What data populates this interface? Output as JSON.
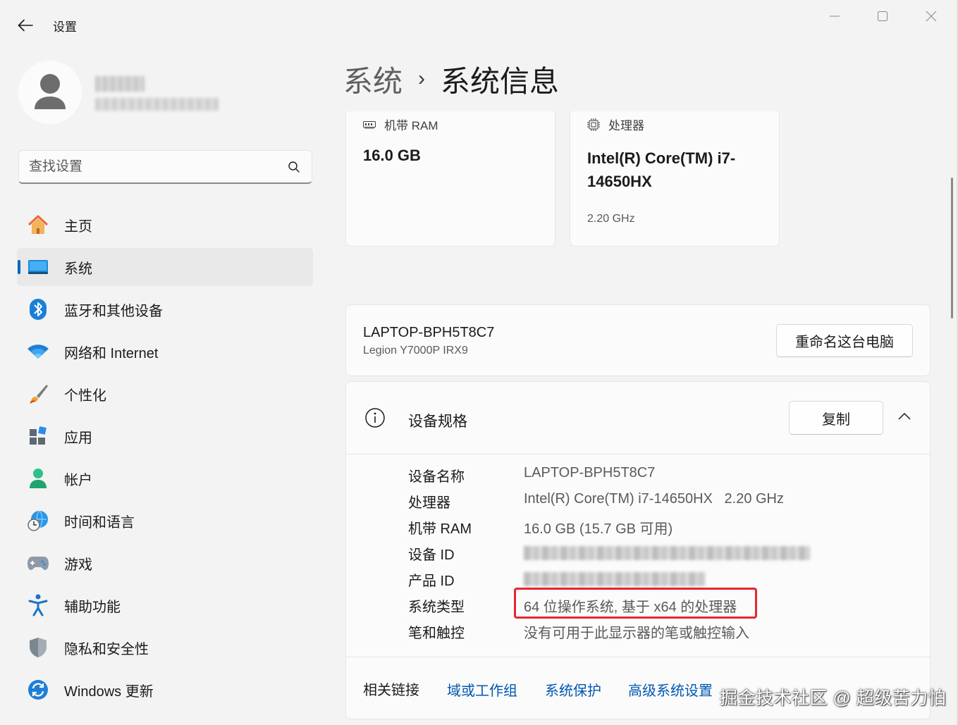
{
  "window": {
    "app_title": "设置",
    "controls": [
      "minimize",
      "maximize",
      "close"
    ]
  },
  "user": {
    "name": "",
    "email": ""
  },
  "search": {
    "placeholder": "查找设置"
  },
  "sidebar": {
    "items": [
      {
        "label": "主页",
        "icon": "home-icon"
      },
      {
        "label": "系统",
        "icon": "system-icon",
        "active": true
      },
      {
        "label": "蓝牙和其他设备",
        "icon": "bluetooth-icon"
      },
      {
        "label": "网络和 Internet",
        "icon": "wifi-icon"
      },
      {
        "label": "个性化",
        "icon": "brush-icon"
      },
      {
        "label": "应用",
        "icon": "apps-icon"
      },
      {
        "label": "帐户",
        "icon": "account-icon"
      },
      {
        "label": "时间和语言",
        "icon": "globe-clock-icon"
      },
      {
        "label": "游戏",
        "icon": "gamepad-icon"
      },
      {
        "label": "辅助功能",
        "icon": "accessibility-icon"
      },
      {
        "label": "隐私和安全性",
        "icon": "shield-icon"
      },
      {
        "label": "Windows 更新",
        "icon": "update-icon"
      }
    ]
  },
  "breadcrumb": {
    "parent": "系统",
    "separator": "›",
    "current": "系统信息"
  },
  "summary_cards": {
    "ram": {
      "label": "机带 RAM",
      "value": "16.0 GB"
    },
    "cpu": {
      "label": "处理器",
      "value": "Intel(R) Core(TM) i7-14650HX",
      "frequency": "2.20 GHz"
    }
  },
  "device": {
    "name": "LAPTOP-BPH5T8C7",
    "model": "Legion Y7000P IRX9",
    "rename_label": "重命名这台电脑"
  },
  "specs": {
    "title": "设备规格",
    "copy_label": "复制",
    "rows": [
      {
        "key": "设备名称",
        "value": "LAPTOP-BPH5T8C7"
      },
      {
        "key": "处理器",
        "value": "Intel(R) Core(TM) i7-14650HX   2.20 GHz"
      },
      {
        "key": "机带 RAM",
        "value": "16.0 GB (15.7 GB 可用)"
      },
      {
        "key": "设备 ID",
        "value": ""
      },
      {
        "key": "产品 ID",
        "value": ""
      },
      {
        "key": "系统类型",
        "value": "64 位操作系统, 基于 x64 的处理器",
        "highlighted": true
      },
      {
        "key": "笔和触控",
        "value": "没有可用于此显示器的笔或触控输入"
      }
    ]
  },
  "related": {
    "label": "相关链接",
    "links": [
      "域或工作组",
      "系统保护",
      "高级系统设置"
    ]
  },
  "watermark": "掘金技术社区 @ 超级苦力怕",
  "colors": {
    "accent": "#0067c0",
    "link": "#0058b0",
    "highlight": "#e8262d",
    "background": "#f3f3f3",
    "card": "#fbfbfb"
  }
}
